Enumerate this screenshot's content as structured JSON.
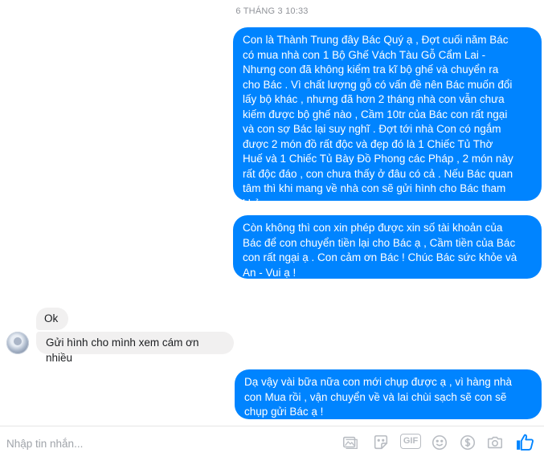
{
  "thread": {
    "timestamp": "6 THÁNG 3 10:33",
    "messages": [
      {
        "id": "b1",
        "direction": "outgoing",
        "text": "Con là Thành Trung đây Bác Quý ạ , Đợt cuối năm Bác\ncó mua nhà con 1 Bộ Ghế Vách Tàu Gỗ Cẩm Lai -\nNhưng con đã không kiểm tra kĩ bộ ghế và chuyển ra\ncho Bác . Vì chất lượng gỗ có vấn đề nên Bác muốn đổi\nlấy bộ khác , nhưng đã hơn 2 tháng nhà con vẫn chưa\nkiếm được bộ ghế nào , Cầm 10tr của Bác con rất ngại\nvà con sợ Bác lại suy nghĩ . Đợt tới nhà Con có ngắm\nđược 2 món đồ rất độc và đẹp đó là 1 Chiếc Tủ Thờ\nHuế và 1 Chiếc Tủ Bày Đồ Phong các Pháp , 2 món này\nrất độc đáo , con chưa thấy ở đâu có cả . Nếu Bác quan\ntâm thì khi mang về nhà con sẽ gửi hình cho Bác tham\nkhảo ạ"
      },
      {
        "id": "b2",
        "direction": "outgoing",
        "text": "Còn không thì con xin phép được xin số tài khoản của\nBác để con chuyển tiền lại cho Bác ạ , Cầm tiền của Bác\ncon rất ngại ạ  . Con cảm ơn Bác ! Chúc Bác sức khỏe và\nAn - Vui ạ !"
      },
      {
        "id": "r1",
        "direction": "incoming",
        "text": "Ok"
      },
      {
        "id": "r2",
        "direction": "incoming",
        "text": "Gửi hình cho mình xem cám ơn nhiều"
      },
      {
        "id": "b3",
        "direction": "outgoing",
        "text": "Dạ vậy vài bữa nữa con mới chụp được ạ , vì hàng nhà\ncon Mua rồi , vận chuyển về và lai chùi sạch sẽ con sẽ\nchụp gửi Bác ạ !"
      }
    ]
  },
  "composer": {
    "placeholder": "Nhập tin nhắn...",
    "gif_label": "GIF",
    "tools": [
      "image-icon",
      "sticker-icon",
      "gif-icon",
      "emoji-icon",
      "dollar-icon",
      "camera-icon",
      "thumbs-up-icon"
    ]
  },
  "colors": {
    "outgoing_bubble": "#0084ff",
    "incoming_bubble": "#f1f0f0",
    "like": "#0084ff",
    "tool": "#b8bcc2"
  }
}
